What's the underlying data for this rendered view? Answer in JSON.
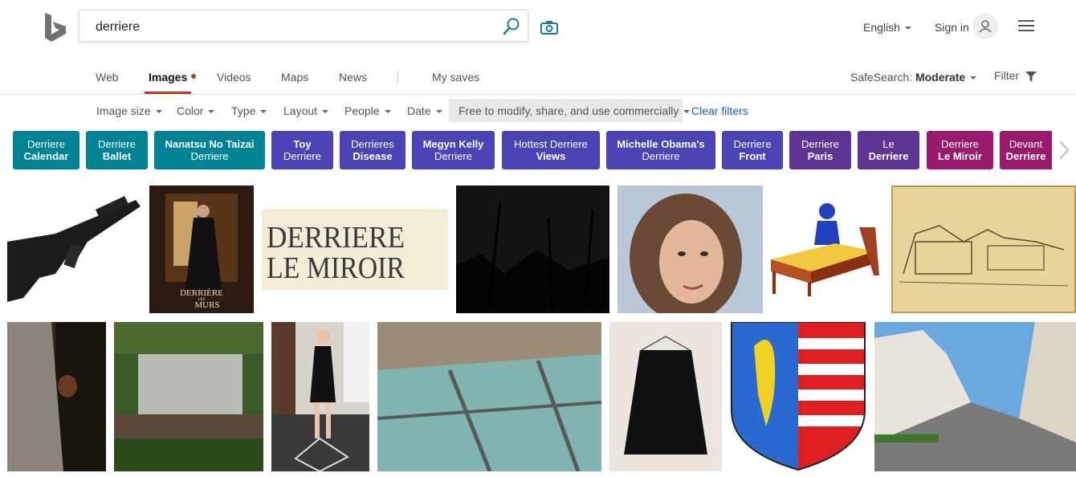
{
  "header": {
    "search_query": "derriere",
    "language": "English",
    "sign_in": "Sign in"
  },
  "tabs": [
    {
      "label": "Web"
    },
    {
      "label": "Images"
    },
    {
      "label": "Videos"
    },
    {
      "label": "Maps"
    },
    {
      "label": "News"
    },
    {
      "label": "My saves"
    }
  ],
  "safesearch": {
    "label": "SafeSearch:",
    "value": "Moderate"
  },
  "filter_label": "Filter",
  "filters": [
    {
      "label": "Image size"
    },
    {
      "label": "Color"
    },
    {
      "label": "Type"
    },
    {
      "label": "Layout"
    },
    {
      "label": "People"
    },
    {
      "label": "Date"
    }
  ],
  "license_filter": "Free to modify, share, and use commercially",
  "clear_filters": "Clear filters",
  "related": [
    {
      "line1": "Derriere",
      "line2": "Calendar",
      "color": "#008394"
    },
    {
      "line1": "Derriere",
      "line2": "Ballet",
      "color": "#008394"
    },
    {
      "line1": "Nanatsu No Taizai",
      "line2": "Derriere",
      "color": "#008394"
    },
    {
      "line1": "Toy",
      "line2": "Derriere",
      "color": "#4a44b6"
    },
    {
      "line1": "Derrieres",
      "line2": "Disease",
      "color": "#4a44b6"
    },
    {
      "line1": "Megyn Kelly",
      "line2": "Derriere",
      "color": "#4a44b6"
    },
    {
      "line1": "Hottest Derriere",
      "line2": "Views",
      "color": "#4a44b6"
    },
    {
      "line1": "Michelle Obama's",
      "line2": "Derriere",
      "color": "#4a44b6"
    },
    {
      "line1": "Derriere",
      "line2": "Front",
      "color": "#4a44b6"
    },
    {
      "line1": "Derriere",
      "line2": "Paris",
      "color": "#5d3393"
    },
    {
      "line1": "Le",
      "line2": "Derriere",
      "color": "#5d3393"
    },
    {
      "line1": "Derriere",
      "line2": "Le Miroir",
      "color": "#9c1a6d"
    },
    {
      "line1": "Devant",
      "line2": "Derriere",
      "color": "#9c1a6d"
    }
  ],
  "images": {
    "poster_line1": "DERRIÈRE",
    "poster_line2": "LES",
    "poster_line3": "MURS",
    "miroir_line1": "DERRIERE",
    "miroir_line2": "LE MIROIR"
  }
}
